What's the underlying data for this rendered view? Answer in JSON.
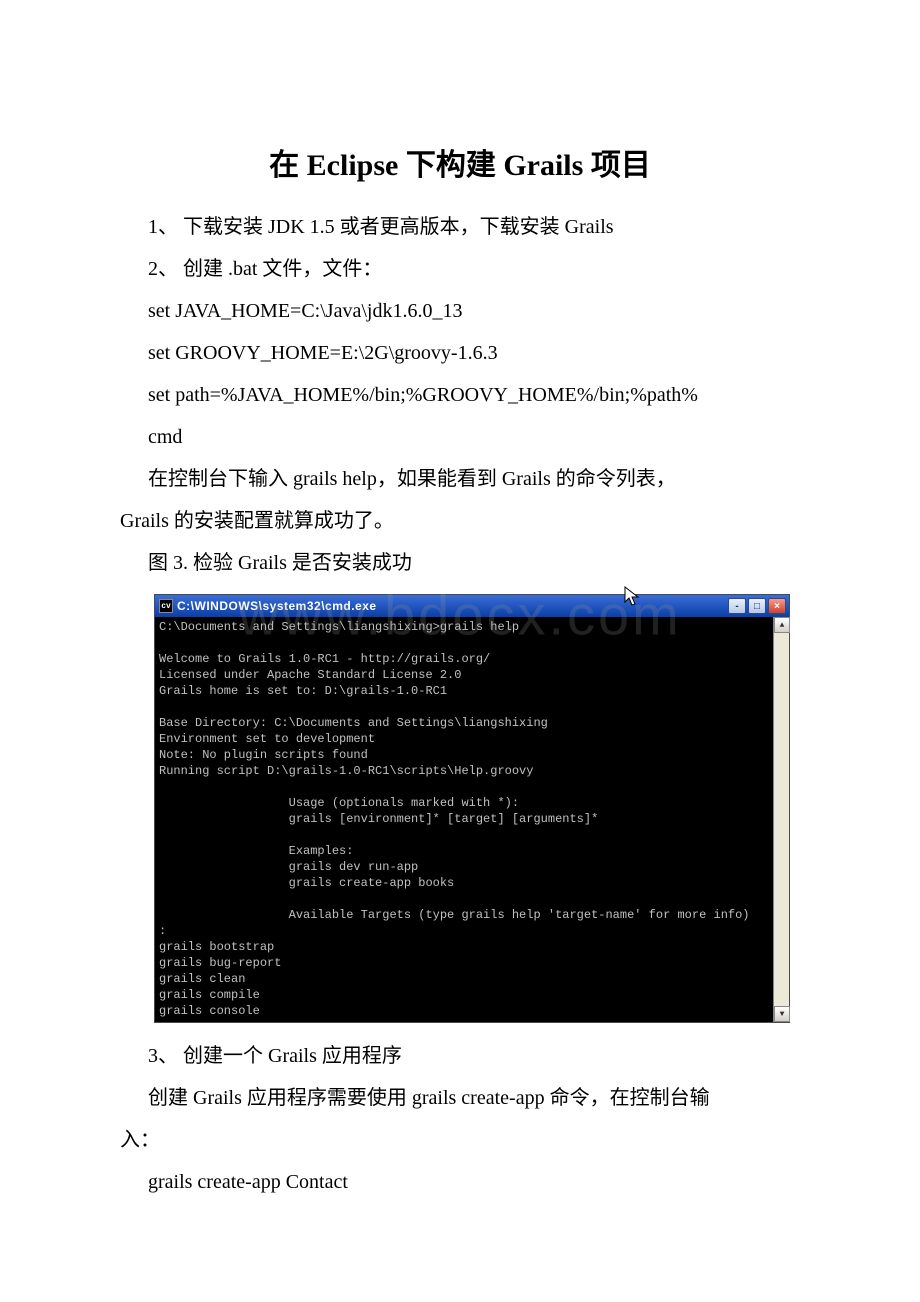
{
  "title": "在 Eclipse 下构建 Grails 项目",
  "p1": "1、 下载安装 JDK 1.5 或者更高版本，下载安装 Grails",
  "p2": "2、 创建 .bat 文件，文件：",
  "c1": "set JAVA_HOME=C:\\Java\\jdk1.6.0_13",
  "c2": "set GROOVY_HOME=E:\\2G\\groovy-1.6.3",
  "c3": "set path=%JAVA_HOME%/bin;%GROOVY_HOME%/bin;%path%",
  "c4": "cmd",
  "p3a": "在控制台下输入 grails help，如果能看到 Grails 的命令列表，",
  "p3b": "Grails 的安装配置就算成功了。",
  "p4": "图 3. 检验 Grails 是否安装成功",
  "console": {
    "icon_text": "cv",
    "title": "C:\\WINDOWS\\system32\\cmd.exe",
    "btn_min": "-",
    "btn_max": "□",
    "btn_close": "×",
    "scroll_up": "▲",
    "scroll_down": "▼",
    "content": "C:\\Documents and Settings\\liangshixing>grails help\n\nWelcome to Grails 1.0-RC1 - http://grails.org/\nLicensed under Apache Standard License 2.0\nGrails home is set to: D:\\grails-1.0-RC1\n\nBase Directory: C:\\Documents and Settings\\liangshixing\nEnvironment set to development\nNote: No plugin scripts found\nRunning script D:\\grails-1.0-RC1\\scripts\\Help.groovy\n\n                  Usage (optionals marked with *):\n                  grails [environment]* [target] [arguments]*\n\n                  Examples:\n                  grails dev run-app\n                  grails create-app books\n\n                  Available Targets (type grails help 'target-name' for more info)\n:\ngrails bootstrap\ngrails bug-report\ngrails clean\ngrails compile\ngrails console"
  },
  "p5": "3、 创建一个 Grails 应用程序",
  "p6a": "创建 Grails 应用程序需要使用 grails create-app 命令，在控制台输",
  "p6b": "入：",
  "p7": " grails create-app Contact",
  "watermark": "www.bdocx.com"
}
